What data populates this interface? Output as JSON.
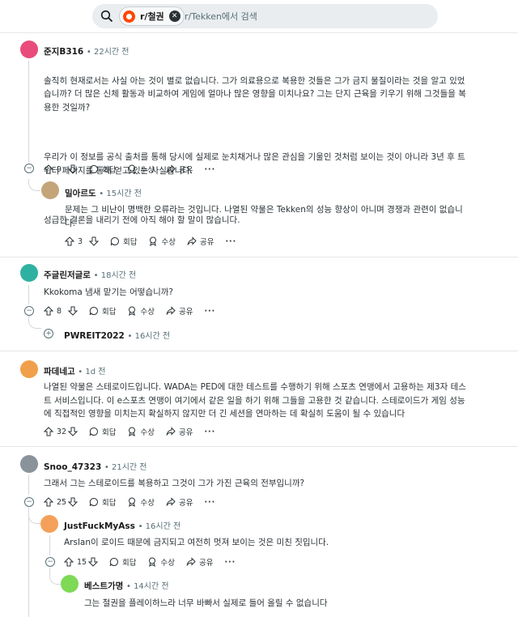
{
  "search": {
    "chip_label": "r/철권",
    "placeholder": "r/Tekken에서 검색"
  },
  "action_labels": {
    "reply": "회답",
    "award": "수상",
    "share": "공유",
    "more": "···"
  },
  "comments": [
    {
      "author": "준지B316",
      "time": "22시간 전",
      "avatar_color": "#e94b7b",
      "body_p1": "솔직히 현재로서는 사실 아는 것이 별로 없습니다. 그가 의료용으로 복용한 것들은 그가 금지 물질이라는 것을 알고 있었\n습니까? 더 많은 신체 활동과 비교하여 게임에 얼마나 많은 영향을 미치나요? 그는 단지 근육을 키우기 위해 그것들을 복\n용한 것일까?",
      "body_p2": "우리가 이 정보를 공식 출처를 통해 당시에 실제로 눈치채거나 많은 관심을 기울인 것처럼 보이는 것이 아니라 3년 후 트\n위터 페이지를 통해 얻고 있는 사실입니다.",
      "body_p3": "성급한 결론을 내리기 전에 아직 해야 할 말이 많습니다.",
      "votes": "9"
    },
    {
      "author": "밀아르도",
      "time": "15시간 전",
      "avatar_color": "#c4a57a",
      "body": "문제는 그 비난이 명백한 오류라는 것입니다. 나열된 약물은 Tekken의 성능 향상이 아니며 경쟁과 관련이 없습니\n다.",
      "votes": "3"
    },
    {
      "author": "주글린저글로",
      "time": "18시간 전",
      "avatar_color": "#2fb1a1",
      "body": "Kkokoma 냄새 맡기는 어떻습니까?",
      "votes": "8"
    },
    {
      "author": "PWREIT2022",
      "time": "16시간 전",
      "collapsed_icon": "+"
    },
    {
      "author": "파데네고",
      "time": "1d 전",
      "avatar_color": "#f0a04b",
      "body": "나열된 약물은 스테로이드입니다. WADA는 PED에 대한 테스트를 수행하기 위해 스포츠 연맹에서 고용하는 제3자 테스\n트 서비스입니다. 이 e스포츠 연맹이 여기에서 같은 일을 하기 위해 그들을 고용한 것 같습니다. 스테로이드가 게임 성능\n에 직접적인 영향을 미치는지 확실하지 않지만 더 긴 세션을 연마하는 데 확실히 도움이 될 수 있습니다",
      "votes": "32"
    },
    {
      "author": "Snoo_47323",
      "time": "21시간 전",
      "avatar_color": "#8a9399",
      "body": "그래서 그는 스테로이드를 복용하고 그것이 그가 가진 근육의 전부입니까?",
      "votes": "25"
    },
    {
      "author": "JustFuckMyAss",
      "time": "16시간 전",
      "avatar_color": "#f5a05a",
      "body": "Arslan이 로이드 때문에 금지되고 여전히 멋져 보이는 것은 미친 짓입니다.",
      "votes": "15"
    },
    {
      "author": "베스트가명",
      "time": "14시간 전",
      "avatar_color": "#7ed957",
      "body": "그는 철권을 플레이하느라 너무 바빠서 실제로 들어 올릴 수 없습니다"
    }
  ],
  "separator": "•"
}
